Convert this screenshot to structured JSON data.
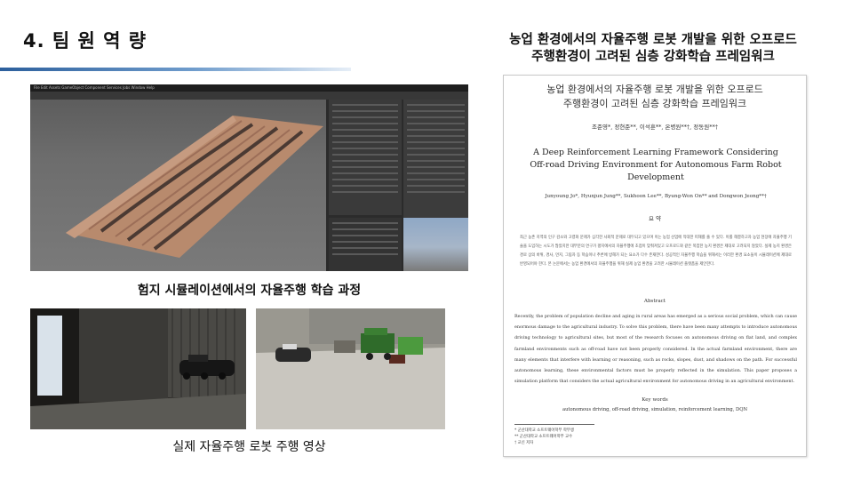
{
  "slide": {
    "title": "4. 팀 원 역 량",
    "paper_heading_line1": "농업 환경에서의 자율주행 로봇 개발을 위한 오프로드",
    "paper_heading_line2": "주행환경이 고려된 심층 강화학습 프레임워크"
  },
  "simulator": {
    "menu": "File  Edit  Assets  GameObject  Component  Services  Jobs  Window  Help",
    "caption": "험지 시뮬레이션에서의 자율주행 학습 과정"
  },
  "videos": {
    "caption": "실제 자율주행 로봇 주행 영상"
  },
  "paper": {
    "ko_title_line1": "농업 환경에서의 자율주행 로봇 개발을 위한 오프로드",
    "ko_title_line2": "주행환경이 고려된 심층 강화학습 프레임워크",
    "ko_authors": "조준영*, 정현준**, 이석훈**, 온병원**†, 정동원**†",
    "en_title_line1": "A Deep Reinforcement Learning Framework Considering",
    "en_title_line2": "Off-road Driving Environment for Autonomous Farm Robot",
    "en_title_line3": "Development",
    "en_authors": "Junyoung Jo*, Hyunjun Jung**, Sukhoon Lee**, Byung-Won On** and Dongwon Jeong**†",
    "ko_abstract_heading": "요 약",
    "ko_abstract": "최근 농촌 지역의 인구 감소와 고령화 문제가 심각한 사회적 문제로 대두되고 있으며 이는 농업 산업에 막대한 피해를 줄 수 있다. 이를 해결하고자 농업 현장에 자율주행 기술을 도입하는 시도가 많았지만 대부분의 연구가 평지에서의 자율주행에 초점이 맞춰져있고 오프로드와 같은 복잡한 농지 환경은 제대로 고려되지 않았다. 실제 농지 환경은 경로 상의 바위, 경사, 먼지, 그림자 등 학습이나 추론에 방해가 되는 요소가 다수 존재한다. 성공적인 자율주행 학습을 위해서는 이러한 환경 요소들이 시뮬레이션에 제대로 반영되어야 한다. 본 논문에서는 농업 환경에서의 자율주행을 위해 실제 농업 환경을 고려한 시뮬레이션 플랫폼을 제안한다.",
    "abstract_heading": "Abstract",
    "abstract": "Recently, the problem of population decline and aging in rural areas has emerged as a serious social problem, which can cause enormous damage to the agricultural industry. To solve this problem, there have been many attempts to introduce autonomous driving technology to agricultural sites, but most of the research focuses on autonomous driving on flat land, and complex farmland environments such as off-road have not been properly considered. In the actual farmland environment, there are many elements that interfere with learning or reasoning, such as rocks, slopes, dust, and shadows on the path. For successful autonomous learning, these environmental factors must be properly reflected in the simulation. This paper proposes a simulation platform that considers the actual agricultural environment for autonomous driving in an agricultural environment.",
    "keywords_heading": "Key words",
    "keywords": "autonomous driving, off-road driving, simulation, reinforcement learning, DQN",
    "footnote1": "* 군산대학교 소프트웨어학부 학부생",
    "footnote2": "** 군산대학교 소프트웨어학부 교수",
    "footnote3": "† 교신 저자"
  }
}
